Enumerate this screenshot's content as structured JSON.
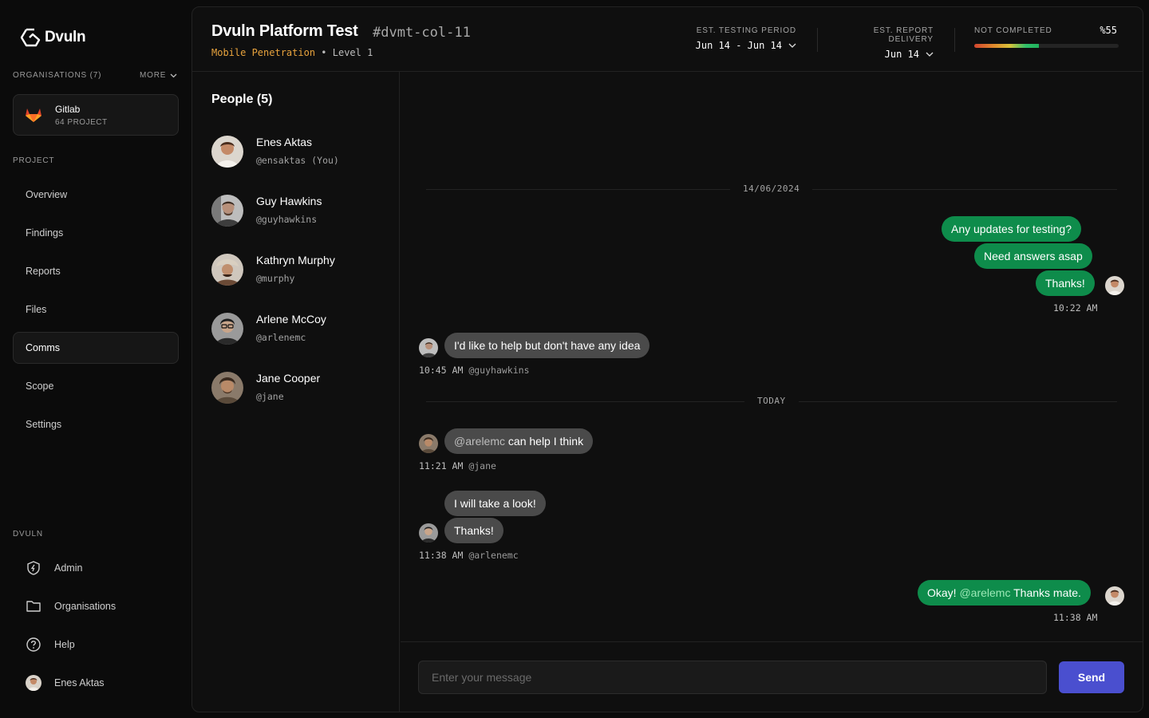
{
  "brand": {
    "name": "Dvuln"
  },
  "sidebar": {
    "organisations_label": "ORGANISATIONS (7)",
    "more_label": "MORE",
    "org": {
      "name": "Gitlab",
      "projects": "64 PROJECT"
    },
    "project_label": "PROJECT",
    "nav": [
      {
        "label": "Overview"
      },
      {
        "label": "Findings"
      },
      {
        "label": "Reports"
      },
      {
        "label": "Files"
      },
      {
        "label": "Comms",
        "active": true
      },
      {
        "label": "Scope"
      },
      {
        "label": "Settings"
      }
    ],
    "dvuln_label": "DVULN",
    "bottom": [
      {
        "label": "Admin",
        "icon": "shield-icon"
      },
      {
        "label": "Organisations",
        "icon": "folder-icon"
      },
      {
        "label": "Help",
        "icon": "help-icon"
      },
      {
        "label": "Enes Aktas",
        "icon": "avatar"
      }
    ]
  },
  "header": {
    "title": "Dvuln Platform Test",
    "project_id": "#dvmt-col-11",
    "test_type": "Mobile Penetration",
    "separator": "•",
    "level": "Level 1",
    "testing_period": {
      "label": "EST. TESTING PERIOD",
      "value": "Jun 14 - Jun 14"
    },
    "report_delivery": {
      "label": "EST. REPORT DELIVERY",
      "value": "Jun 14"
    },
    "progress": {
      "label": "NOT COMPLETED",
      "percent_text": "%55",
      "value": 0.45
    }
  },
  "people": {
    "title": "People (5)",
    "list": [
      {
        "name": "Enes Aktas",
        "handle": "@ensaktas (You)"
      },
      {
        "name": "Guy Hawkins",
        "handle": "@guyhawkins"
      },
      {
        "name": "Kathryn Murphy",
        "handle": "@murphy"
      },
      {
        "name": "Arlene McCoy",
        "handle": "@arlenemc"
      },
      {
        "name": "Jane Cooper",
        "handle": "@jane"
      }
    ]
  },
  "chat": {
    "date_1": "14/06/2024",
    "date_2": "TODAY",
    "msg_1": "Any updates for testing?",
    "msg_2": "Need answers asap",
    "msg_3": "Thanks!",
    "time_1": "10:22 AM",
    "msg_4": "I'd like to help but don't have any idea",
    "time_2": "10:45 AM",
    "handle_2": "@guyhawkins",
    "msg_5_mention": "@arelemc",
    "msg_5_text": " can help I think",
    "time_3": "11:21 AM",
    "handle_3": "@jane",
    "msg_6": "I will take a look!",
    "msg_7": "Thanks!",
    "time_4": "11:38 AM",
    "handle_4": "@arlenemc",
    "msg_8_pre": "Okay! ",
    "msg_8_mention": "@arelemc",
    "msg_8_post": " Thanks mate.",
    "time_5": "11:38 AM"
  },
  "composer": {
    "placeholder": "Enter your message",
    "send_label": "Send"
  },
  "colors": {
    "accent": "#4a4fcf",
    "my_bubble": "#0e8c4b",
    "other_bubble": "#4a4a4a",
    "test_type": "#e8a33d"
  }
}
